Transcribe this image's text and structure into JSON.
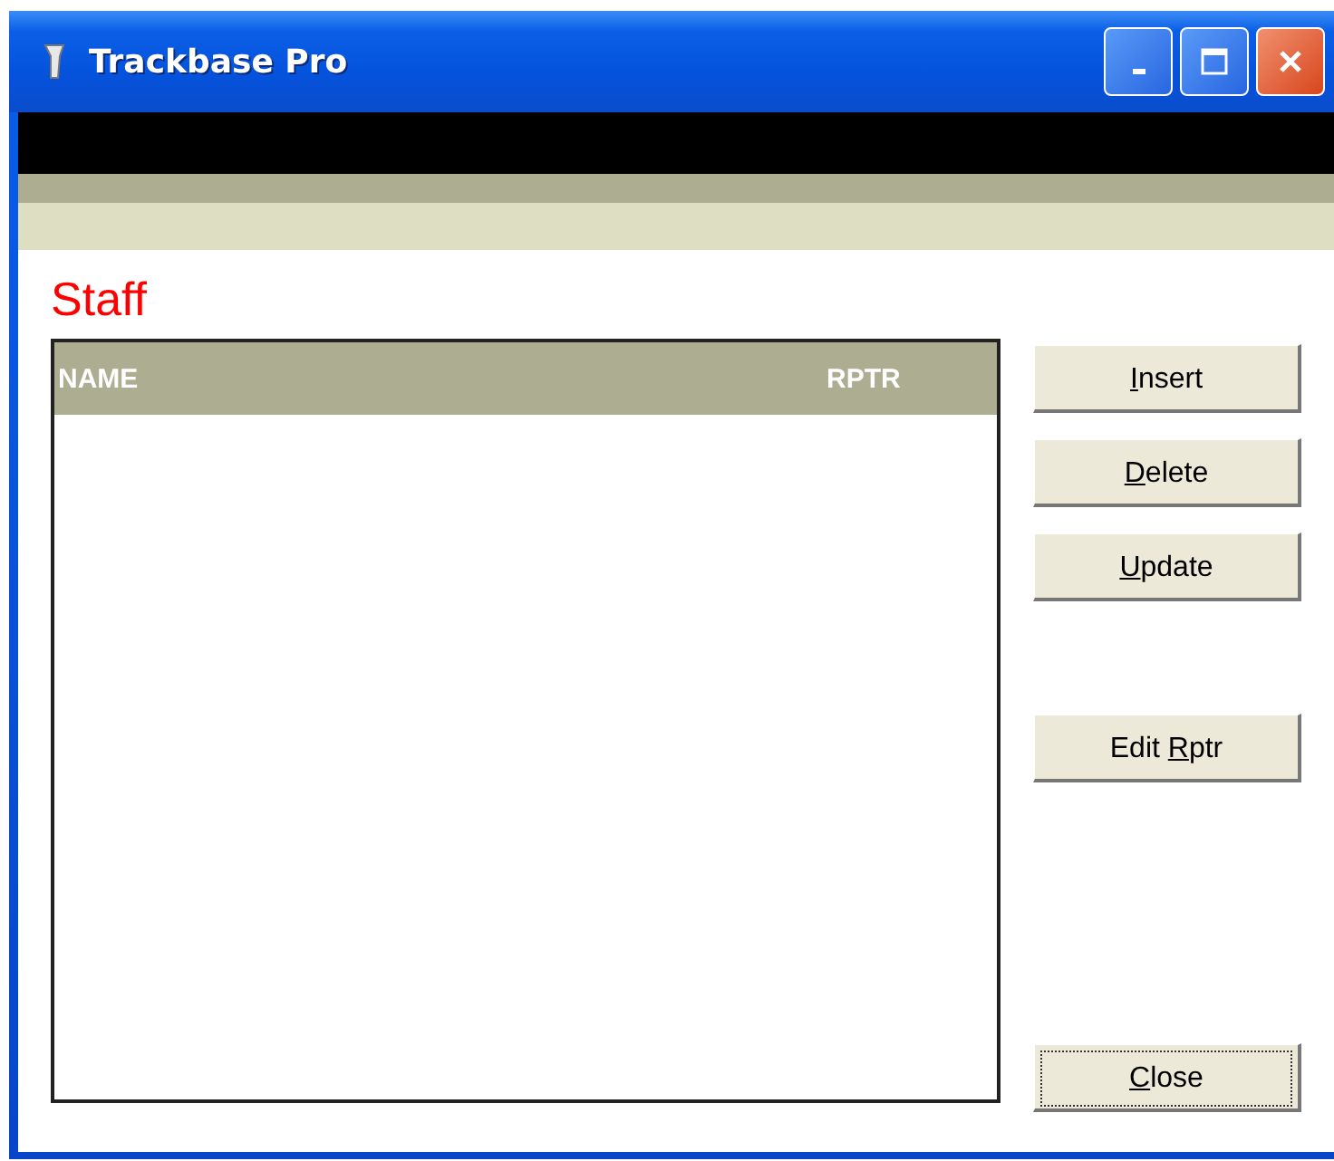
{
  "window": {
    "title": "Trackbase Pro"
  },
  "heading": "Staff",
  "table": {
    "columns": [
      "NAME",
      "RPTR"
    ]
  },
  "button_groups": [
    [
      {
        "key": "I",
        "after": "nsert",
        "focused": false
      },
      {
        "key": "D",
        "after": "elete",
        "focused": false
      },
      {
        "key": "U",
        "after": "pdate",
        "focused": false
      }
    ],
    [
      {
        "before": "Edit ",
        "key": "R",
        "after": "ptr",
        "focused": false
      }
    ],
    [
      {
        "key": "C",
        "after": "lose",
        "focused": true
      }
    ]
  ]
}
